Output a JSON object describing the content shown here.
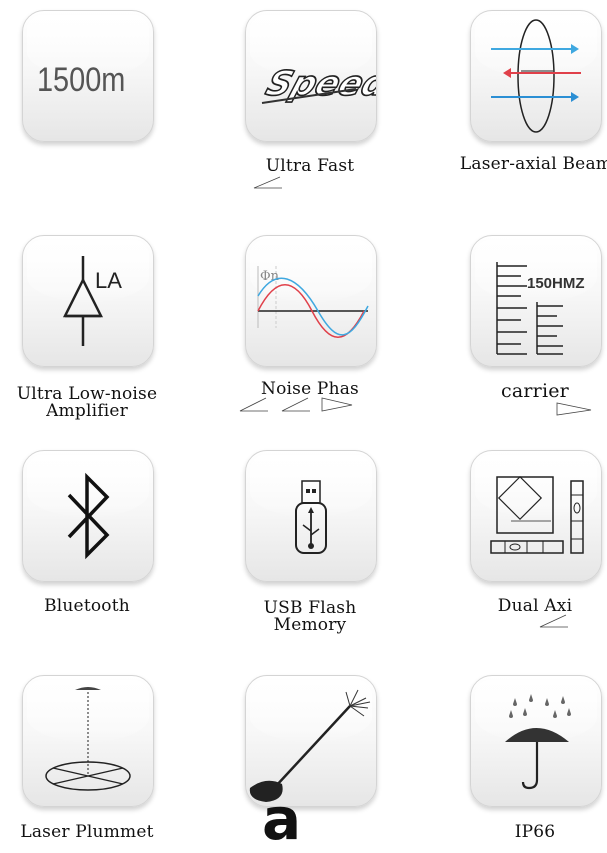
{
  "tiles": [
    {
      "name": "range-1500m",
      "text": "1500m",
      "label": ""
    },
    {
      "name": "speed",
      "text": "Speed",
      "label": "Ultra Fast"
    },
    {
      "name": "laser-axial",
      "label": "Laser-axial Beam"
    },
    {
      "name": "amplifier",
      "text": "LA",
      "label": "Ultra Low-noise Amplifier"
    },
    {
      "name": "noise-phase",
      "text": "Φn",
      "label": "Noise Phas"
    },
    {
      "name": "carrier",
      "text": "150HMZ",
      "label": "carrier"
    },
    {
      "name": "bluetooth",
      "label": "Bluetooth"
    },
    {
      "name": "usb",
      "label": "USB Flash Memory"
    },
    {
      "name": "dual-axis",
      "label": "Dual Axi"
    },
    {
      "name": "plummet",
      "label": "Laser Plummet"
    },
    {
      "name": "tilt-laser",
      "label": ""
    },
    {
      "name": "ip66",
      "label": "IP66"
    }
  ],
  "stray_letter": "a",
  "colors": {
    "blue": "#3fa8e0",
    "red": "#e0404a",
    "dark": "#222222"
  }
}
